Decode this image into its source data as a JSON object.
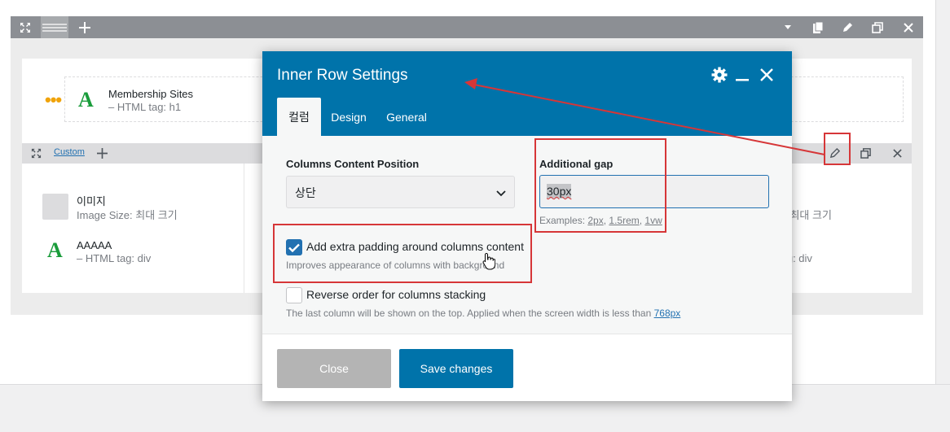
{
  "outer_toolbar": {
    "icons": [
      "expand-icon",
      "drag-handle-icon",
      "plus-icon",
      "caret-down-icon",
      "clipboard-icon",
      "pencil-icon",
      "duplicate-icon",
      "close-icon"
    ]
  },
  "heading_element": {
    "title": "Membership Sites",
    "subtitle": "– HTML tag: h1"
  },
  "inner_toolbar": {
    "custom_label": "Custom"
  },
  "left_column": {
    "image_title": "이미지",
    "image_sub": "Image Size: 최대 크기",
    "text_title": "AAAAA",
    "text_sub": "– HTML tag: div"
  },
  "right_column": {
    "image_sub_partial": "e: 최대 크기",
    "text_sub_partial": "tag: div"
  },
  "modal": {
    "title": "Inner Row Settings",
    "tabs": [
      {
        "label": "컬럼",
        "active": true
      },
      {
        "label": "Design",
        "active": false
      },
      {
        "label": "General",
        "active": false
      }
    ],
    "columns_content_position": {
      "label": "Columns Content Position",
      "value": "상단"
    },
    "additional_gap": {
      "label": "Additional gap",
      "value": "30px",
      "examples_prefix": "Examples: ",
      "examples": [
        "2px",
        "1.5rem",
        "1vw"
      ]
    },
    "extra_padding": {
      "checked": true,
      "label": "Add extra padding around columns content",
      "description": "Improves appearance of columns with background"
    },
    "reverse_order": {
      "checked": false,
      "label": "Reverse order for columns stacking",
      "description_prefix": "The last column will be shown on the top. Applied when the screen width is less than ",
      "description_link": "768px"
    },
    "buttons": {
      "close": "Close",
      "save": "Save changes"
    }
  },
  "colors": {
    "header_blue": "#0073aa",
    "annotation_red": "#d63638",
    "element_green": "#1a9c3b",
    "dots_orange": "#f0a30a"
  }
}
